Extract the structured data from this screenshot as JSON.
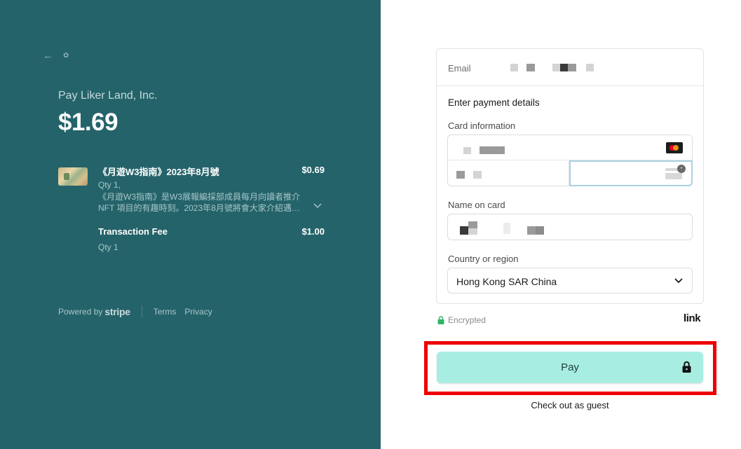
{
  "summary": {
    "pay_to": "Pay Liker Land, Inc.",
    "amount": "$1.69"
  },
  "items": [
    {
      "name": "《月遊W3指南》2023年8月號",
      "price": "$0.69",
      "qty": "Qty 1,",
      "desc_line1": "《月遊W3指南》是W3展報編採部成員每月向讀者推介",
      "desc_line2": "NFT 項目的有趣時刻。2023年8月號將會大家介紹遇到..."
    },
    {
      "name": "Transaction Fee",
      "price": "$1.00",
      "qty": "Qty 1"
    }
  ],
  "footer": {
    "powered_prefix": "Powered by",
    "powered_brand": "stripe",
    "terms": "Terms",
    "privacy": "Privacy"
  },
  "form": {
    "email_label": "Email",
    "payment_title": "Enter payment details",
    "card_label": "Card information",
    "name_label": "Name on card",
    "country_label": "Country or region",
    "country_value": "Hong Kong SAR China"
  },
  "encrypted_label": "Encrypted",
  "link_logo": "link",
  "pay_button": "Pay",
  "guest_link": "Check out as guest",
  "colors": {
    "left_panel": "#24636a",
    "pay_button": "#a8ede2",
    "highlight": "#ee0000"
  }
}
